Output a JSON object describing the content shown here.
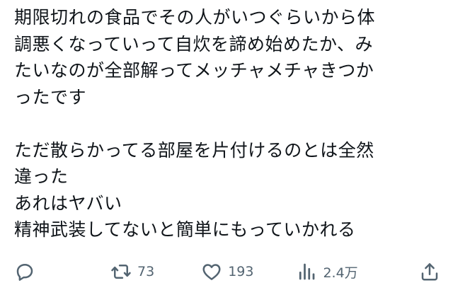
{
  "tweet": {
    "lines": [
      "期限切れの食品でその人がいつぐらいから体",
      "調悪くなっていって自炊を諦め始めたか、み",
      "たいなのが全部解ってメッチャメチャきつか",
      "ったです",
      "",
      "ただ散らかってる部屋を片付けるのとは全然",
      "違った",
      "あれはヤバい",
      "精神武装してないと簡単にもっていかれる"
    ]
  },
  "actions": {
    "reply": {
      "icon": "reply-icon"
    },
    "retweet": {
      "icon": "retweet-icon",
      "count": "73"
    },
    "like": {
      "icon": "heart-icon",
      "count": "193"
    },
    "views": {
      "icon": "views-icon",
      "count": "2.4万"
    },
    "share": {
      "icon": "share-icon"
    }
  },
  "colors": {
    "text": "#0f1419",
    "muted": "#536471",
    "background": "#ffffff"
  }
}
